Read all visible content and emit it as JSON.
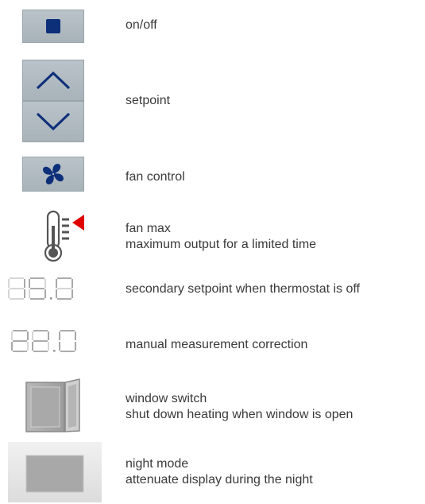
{
  "items": [
    {
      "icon": "stop-square-icon",
      "lines": [
        "on/off"
      ]
    },
    {
      "icon": "chevron-up-down-icon",
      "lines": [
        "setpoint"
      ]
    },
    {
      "icon": "fan-icon",
      "lines": [
        "fan control"
      ]
    },
    {
      "icon": "thermometer-alert-icon",
      "lines": [
        "fan max",
        "maximum output for a limited time"
      ]
    },
    {
      "icon": "seven-segment-display-icon",
      "display": "15.0",
      "lines": [
        "secondary setpoint when thermostat is off"
      ]
    },
    {
      "icon": "seven-segment-display-icon",
      "display": "22.0",
      "lines": [
        "manual measurement correction"
      ]
    },
    {
      "icon": "window-icon",
      "lines": [
        "window switch",
        "shut down heating when window is open"
      ]
    },
    {
      "icon": "night-mode-panel-icon",
      "lines": [
        "night mode",
        "attenuate display during the night"
      ]
    }
  ],
  "colors": {
    "accent": "#0d2f7a",
    "button": "#b0bac0",
    "alert": "#e00000",
    "segment": "#c8c8c8"
  }
}
